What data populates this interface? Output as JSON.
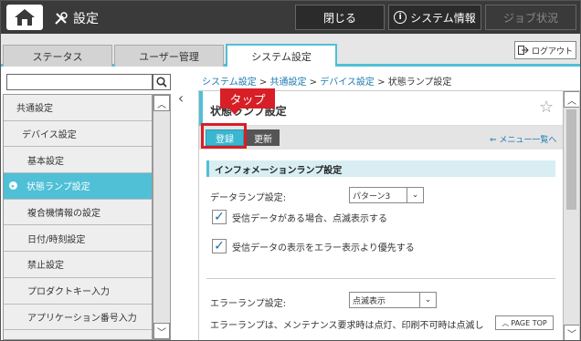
{
  "topbar": {
    "title": "設定",
    "close_label": "閉じる",
    "sysinfo_label": "システム情報",
    "job_status_label": "ジョブ状況"
  },
  "tabs": [
    {
      "label": "ステータス"
    },
    {
      "label": "ユーザー管理"
    },
    {
      "label": "システム設定",
      "active": true
    }
  ],
  "logout_label": "ログアウト",
  "search": {
    "value": ""
  },
  "sidebar": {
    "items": [
      {
        "label": "共通設定",
        "level": 1
      },
      {
        "label": "デバイス設定",
        "level": 2
      },
      {
        "label": "基本設定",
        "level": 3
      },
      {
        "label": "状態ランプ設定",
        "level": 3,
        "active": true
      },
      {
        "label": "複合機情報の設定",
        "level": 3
      },
      {
        "label": "日付/時刻設定",
        "level": 3
      },
      {
        "label": "禁止設定",
        "level": 3
      },
      {
        "label": "プロダクトキー入力",
        "level": 3
      },
      {
        "label": "アプリケーション番号入力",
        "level": 3
      }
    ]
  },
  "breadcrumb": {
    "links": [
      "システム設定",
      "共通設定",
      "デバイス設定"
    ],
    "separator": ">",
    "current": "状態ランプ設定"
  },
  "page": {
    "title": "状態ランプ設定",
    "register_label": "登録",
    "update_label": "更新",
    "menu_list_label": "メニュー一覧へ"
  },
  "section": {
    "title": "インフォメーションランプ設定",
    "data_lamp_label": "データランプ設定:",
    "data_lamp_value": "パターン3",
    "check1_label": "受信データがある場合、点滅表示する",
    "check1_checked": true,
    "check2_label": "受信データの表示をエラー表示より優先する",
    "check2_checked": true,
    "error_lamp_label": "エラーランプ設定:",
    "error_lamp_value": "点滅表示",
    "description": "エラーランプは、メンテナンス要求時は点灯、印刷不可時は点滅し"
  },
  "pagetop_label": "PAGE TOP",
  "annotation": {
    "tap_label": "タップ",
    "color": "#d81e26"
  },
  "colors": {
    "accent": "#4fc0d6",
    "topbar": "#3a3a3a"
  }
}
